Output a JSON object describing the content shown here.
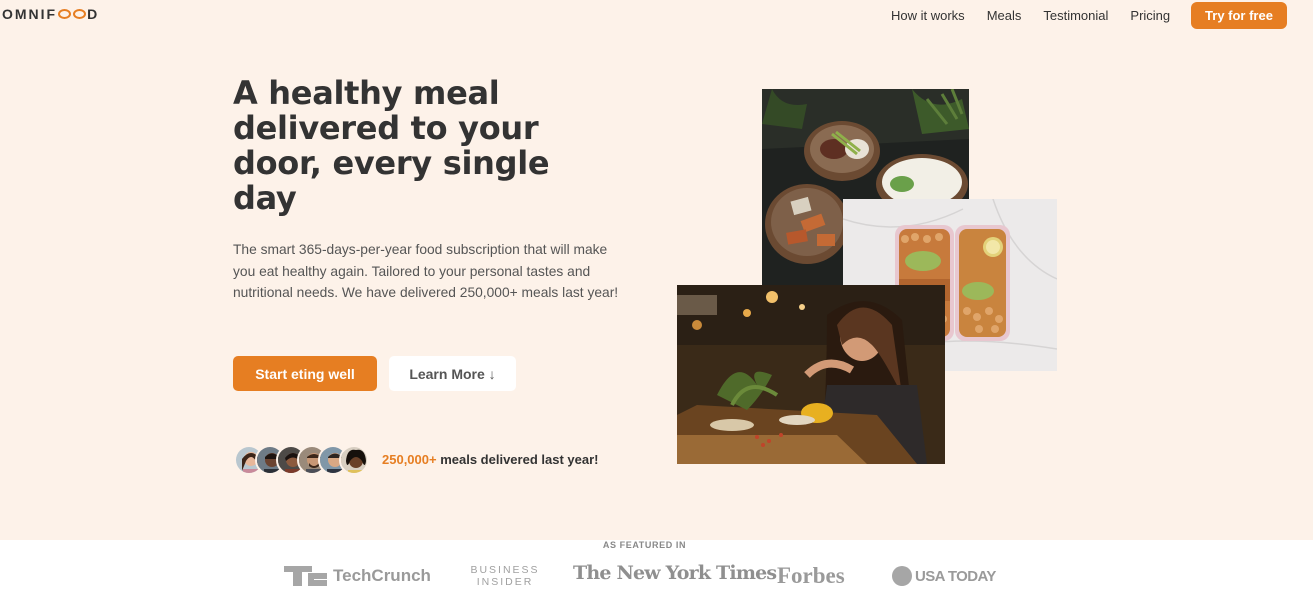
{
  "header": {
    "logo": {
      "before": "OMNIF",
      "after": "D"
    },
    "nav": [
      "How it works",
      "Meals",
      "Testimonial",
      "Pricing"
    ],
    "cta": "Try for free"
  },
  "hero": {
    "title": "A healthy meal delivered to your door, every single day",
    "description": "The smart 365-days-per-year food subscription that will make you eat healthy again. Tailored to your personal tastes and nutritional needs. We have delivered 250,000+ meals last year!",
    "primary_button": "Start eting well",
    "secondary_button": "Learn More ↓",
    "delivered_highlight": "250,000+",
    "delivered_text": " meals delivered last year!"
  },
  "featured": {
    "label": "AS FEATURED IN",
    "logos": {
      "techcrunch": "TechCrunch",
      "business_insider_1": "BUSINESS",
      "business_insider_2": "INSIDER",
      "nyt": "The New York Times",
      "forbes": "Forbes",
      "usa_today": "USA TODAY"
    }
  },
  "colors": {
    "accent": "#e67e22",
    "hero_bg": "#fdf2e9",
    "text": "#333333"
  }
}
